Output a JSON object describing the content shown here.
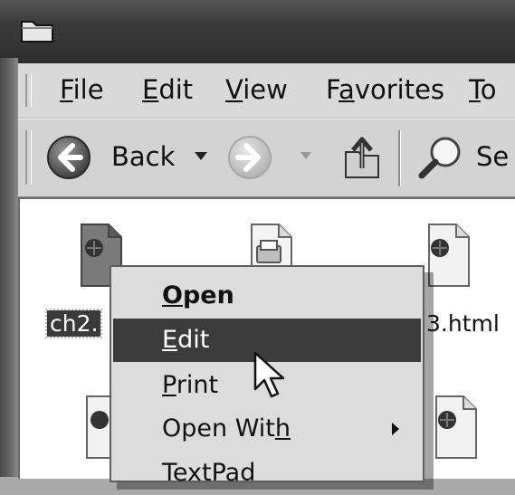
{
  "menubar": {
    "items": [
      {
        "pre": "",
        "u": "F",
        "post": "ile"
      },
      {
        "pre": "",
        "u": "E",
        "post": "dit"
      },
      {
        "pre": "",
        "u": "V",
        "post": "iew"
      },
      {
        "pre": "F",
        "u": "a",
        "post": "vorites"
      },
      {
        "pre": "",
        "u": "T",
        "post": "o"
      }
    ]
  },
  "toolbar": {
    "back_label": "Back",
    "search_label_partial": "Se"
  },
  "files": [
    {
      "label": "ch2.",
      "icon": "html-document-icon",
      "selected": true
    },
    {
      "label": "",
      "icon": "printer-document-icon"
    },
    {
      "label": "3.html",
      "icon": "html-document-icon"
    },
    {
      "label": "",
      "icon": "html-document-icon"
    },
    {
      "label": "",
      "icon": "html-document-icon"
    }
  ],
  "context_menu": {
    "items": [
      {
        "pre": "",
        "u": "O",
        "post": "pen",
        "bold": true,
        "active": false,
        "submenu": false
      },
      {
        "pre": "",
        "u": "E",
        "post": "dit",
        "bold": false,
        "active": true,
        "submenu": false
      },
      {
        "pre": "",
        "u": "P",
        "post": "rint",
        "bold": false,
        "active": false,
        "submenu": false
      },
      {
        "pre": "Open Wit",
        "u": "h",
        "post": "",
        "bold": false,
        "active": false,
        "submenu": true
      },
      {
        "pre": "TextPad",
        "u": "",
        "post": "",
        "bold": false,
        "active": false,
        "submenu": false
      }
    ]
  },
  "colors": {
    "titlebar": "#2e2e2e",
    "menu_bg": "#d9d9d9",
    "highlight": "#3b3b3b",
    "content_bg": "#ffffff"
  }
}
